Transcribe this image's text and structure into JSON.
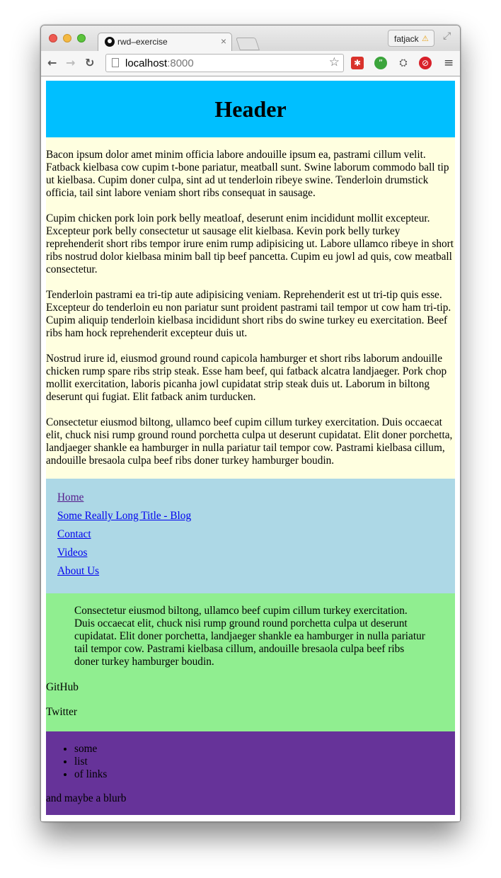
{
  "browser": {
    "tab_title": "rwd–exercise",
    "tab_close": "×",
    "profile_name": "fatjack",
    "url_host": "localhost",
    "url_port": ":8000"
  },
  "page": {
    "header_title": "Header",
    "paragraphs": [
      "Bacon ipsum dolor amet minim officia labore andouille ipsum ea, pastrami cillum velit. Fatback kielbasa cow cupim t-bone pariatur, meatball sunt. Swine laborum commodo ball tip ut kielbasa. Cupim doner culpa, sint ad ut tenderloin ribeye swine. Tenderloin drumstick officia, tail sint labore veniam short ribs consequat in sausage.",
      "Cupim chicken pork loin pork belly meatloaf, deserunt enim incididunt mollit excepteur. Excepteur pork belly consectetur ut sausage elit kielbasa. Kevin pork belly turkey reprehenderit short ribs tempor irure enim rump adipisicing ut. Labore ullamco ribeye in short ribs nostrud dolor kielbasa minim ball tip beef pancetta. Cupim eu jowl ad quis, cow meatball consectetur.",
      "Tenderloin pastrami ea tri-tip aute adipisicing veniam. Reprehenderit est ut tri-tip quis esse. Excepteur do tenderloin eu non pariatur sunt proident pastrami tail tempor ut cow ham tri-tip. Cupim aliquip tenderloin kielbasa incididunt short ribs do swine turkey eu exercitation. Beef ribs ham hock reprehenderit excepteur duis ut.",
      "Nostrud irure id, eiusmod ground round capicola hamburger et short ribs laborum andouille chicken rump spare ribs strip steak. Esse ham beef, qui fatback alcatra landjaeger. Pork chop mollit exercitation, laboris picanha jowl cupidatat strip steak duis ut. Laborum in biltong deserunt qui fugiat. Elit fatback anim turducken.",
      "Consectetur eiusmod biltong, ullamco beef cupim cillum turkey exercitation. Duis occaecat elit, chuck nisi rump ground round porchetta culpa ut deserunt cupidatat. Elit doner porchetta, landjaeger shankle ea hamburger in nulla pariatur tail tempor cow. Pastrami kielbasa cillum, andouille bresaola culpa beef ribs doner turkey hamburger boudin."
    ],
    "nav_links": [
      "Home",
      "Some Really Long Title - Blog",
      "Contact",
      "Videos",
      "About Us"
    ],
    "aside_quote": "Consectetur eiusmod biltong, ullamco beef cupim cillum turkey exercitation. Duis occaecat elit, chuck nisi rump ground round porchetta culpa ut deserunt cupidatat. Elit doner porchetta, landjaeger shankle ea hamburger in nulla pariatur tail tempor cow. Pastrami kielbasa cillum, andouille bresaola culpa beef ribs doner turkey hamburger boudin.",
    "aside_links": [
      "GitHub",
      "Twitter"
    ],
    "footer_list": [
      "some",
      "list",
      "of links"
    ],
    "footer_blurb": "and maybe a blurb"
  },
  "colors": {
    "header_bg": "#00bfff",
    "main_bg": "#ffffe0",
    "nav_bg": "#add8e6",
    "aside_bg": "#90ee90",
    "footer_bg": "#663399"
  },
  "icons": [
    "close-traffic-light",
    "minimize-traffic-light",
    "maximize-traffic-light",
    "back-arrow-icon",
    "forward-arrow-icon",
    "reload-icon",
    "page-icon",
    "star-icon",
    "warning-icon",
    "fullscreen-icon",
    "menu-icon"
  ]
}
